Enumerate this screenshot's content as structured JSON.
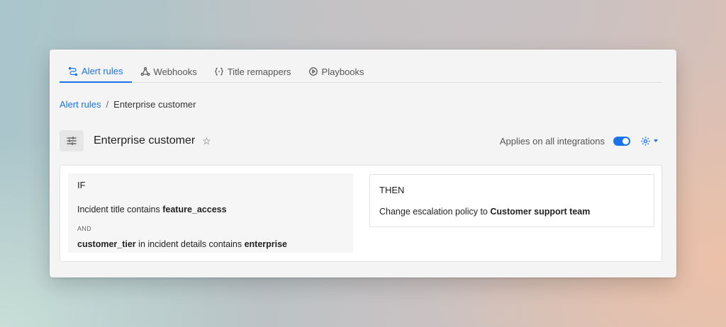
{
  "tabs": [
    {
      "label": "Alert rules",
      "icon": "route-icon",
      "active": true
    },
    {
      "label": "Webhooks",
      "icon": "webhook-icon",
      "active": false
    },
    {
      "label": "Title remappers",
      "icon": "braces-icon",
      "active": false
    },
    {
      "label": "Playbooks",
      "icon": "play-circle-icon",
      "active": false
    }
  ],
  "breadcrumb": {
    "parent": "Alert rules",
    "separator": "/",
    "current": "Enterprise customer"
  },
  "header": {
    "title": "Enterprise customer",
    "star_glyph": "☆",
    "applies_label": "Applies on all integrations",
    "toggle_on": true
  },
  "rule": {
    "if_label": "IF",
    "condition1": {
      "prefix": "Incident title contains ",
      "value": "feature_access"
    },
    "and_label": "AND",
    "condition2": {
      "field": "customer_tier",
      "middle": " in incident details contains ",
      "value": "enterprise"
    },
    "then_label": "THEN",
    "action": {
      "prefix": "Change escalation policy to ",
      "value": "Customer support team"
    }
  },
  "colors": {
    "accent": "#1a73e8",
    "panel_bg": "#f4f4f4"
  }
}
